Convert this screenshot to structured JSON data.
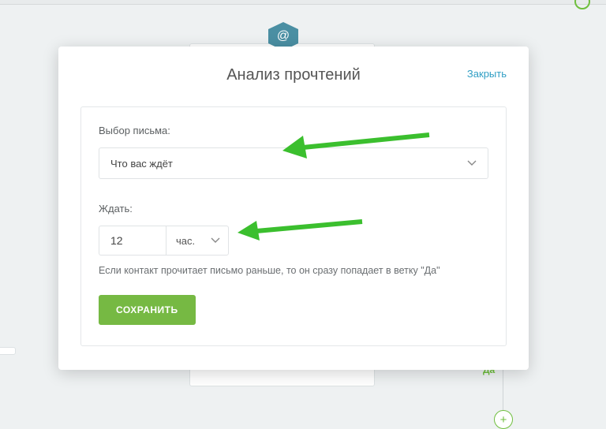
{
  "modal": {
    "title": "Анализ прочтений",
    "close": "Закрыть",
    "letterLabel": "Выбор письма:",
    "letterValue": "Что вас ждёт",
    "waitLabel": "Ждать:",
    "waitValue": "12",
    "waitUnit": "час.",
    "hint": "Если контакт прочитает письмо раньше, то он сразу попадает в ветку \"Да\"",
    "saveLabel": "СОХРАНИТЬ"
  },
  "bg": {
    "yes": "Да",
    "at": "@",
    "plus": "+"
  }
}
